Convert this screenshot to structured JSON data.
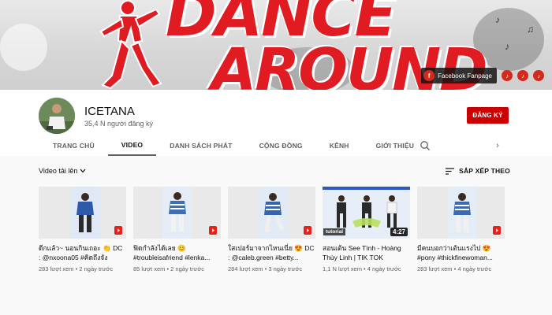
{
  "banner": {
    "art_line1": "DANCE",
    "art_line2": "AROUND",
    "facebook_label": "Facebook Fanpage",
    "brand_color": "#e01b22"
  },
  "channel": {
    "name": "ICETANA",
    "subscribers": "35,4 N người đăng ký",
    "subscribe_label": "ĐĂNG KÝ",
    "subscribe_color": "#cc0000"
  },
  "tabs": [
    {
      "label": "TRANG CHỦ",
      "active": false
    },
    {
      "label": "VIDEO",
      "active": true
    },
    {
      "label": "DANH SÁCH PHÁT",
      "active": false
    },
    {
      "label": "CỘNG ĐỒNG",
      "active": false
    },
    {
      "label": "KÊNH",
      "active": false
    },
    {
      "label": "GIỚI THIỆU",
      "active": false
    }
  ],
  "tab_icons": {
    "search": "search-icon",
    "next": "chevron-right-icon"
  },
  "section": {
    "uploads_label": "Video tải lên",
    "sort_label": "SẮP XẾP THEO"
  },
  "videos": [
    {
      "title": "ดีกแล้ว~ นอนกินเถอะ 👏 DC : @nxoona05 #คิดถึงจังเพาะ...",
      "views": "283 lượt xem",
      "age": "2 ngày trước",
      "short": true,
      "duration": ""
    },
    {
      "title": "ฟิดกำลังได้เลย 😊 #troubleisafriend #lenka...",
      "views": "85 lượt xem",
      "age": "2 ngày trước",
      "short": true,
      "duration": ""
    },
    {
      "title": "ใสเปอร์มาจากไหนเนี่ย 😍 DC : @caleb.green #betty...",
      "views": "284 lượt xem",
      "age": "3 ngày trước",
      "short": true,
      "duration": ""
    },
    {
      "title": "สอนเต้น See Tình - Hoàng Thùy Linh | TIK TOK DANCE...",
      "views": "1,1 N lượt xem",
      "age": "4 ngày trước",
      "short": false,
      "duration": "4:27",
      "thumb_text": "tutorial"
    },
    {
      "title": "มีคนบอกว่าเต้นแรงไป 😍 #pony #thickfinewoman...",
      "views": "283 lượt xem",
      "age": "4 ngày trước",
      "short": true,
      "duration": ""
    }
  ]
}
